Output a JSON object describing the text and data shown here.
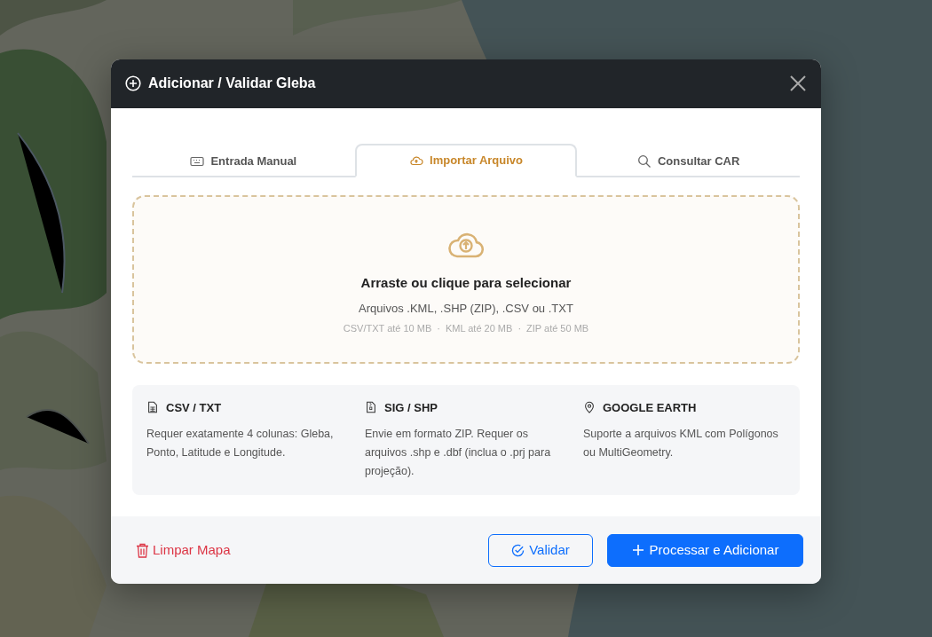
{
  "modal": {
    "title": "Adicionar / Validar Gleba",
    "tabs": [
      {
        "label": "Entrada Manual",
        "selected": false
      },
      {
        "label": "Importar Arquivo",
        "selected": true
      },
      {
        "label": "Consultar CAR",
        "selected": false
      }
    ],
    "dropzone": {
      "heading": "Arraste ou clique para selecionar",
      "formats": "Arquivos .KML, .SHP (ZIP), .CSV ou .TXT",
      "separator": "·",
      "limits": [
        "CSV/TXT até 10 MB",
        "KML até 20 MB",
        "ZIP até 50 MB"
      ]
    },
    "info": [
      {
        "title": "CSV / TXT",
        "text": "Requer exatamente 4 colunas: Gleba, Ponto, Latitude e Longitude."
      },
      {
        "title": "SIG / SHP",
        "text": "Envie em formato ZIP. Requer os arquivos .shp e .dbf (inclua o .prj para projeção)."
      },
      {
        "title": "GOOGLE EARTH",
        "text": "Suporte a arquivos KML com Polígonos ou MultiGeometry."
      }
    ],
    "footer": {
      "clear": "Limpar Mapa",
      "validate": "Validar",
      "submit": "Processar e Adicionar"
    }
  }
}
